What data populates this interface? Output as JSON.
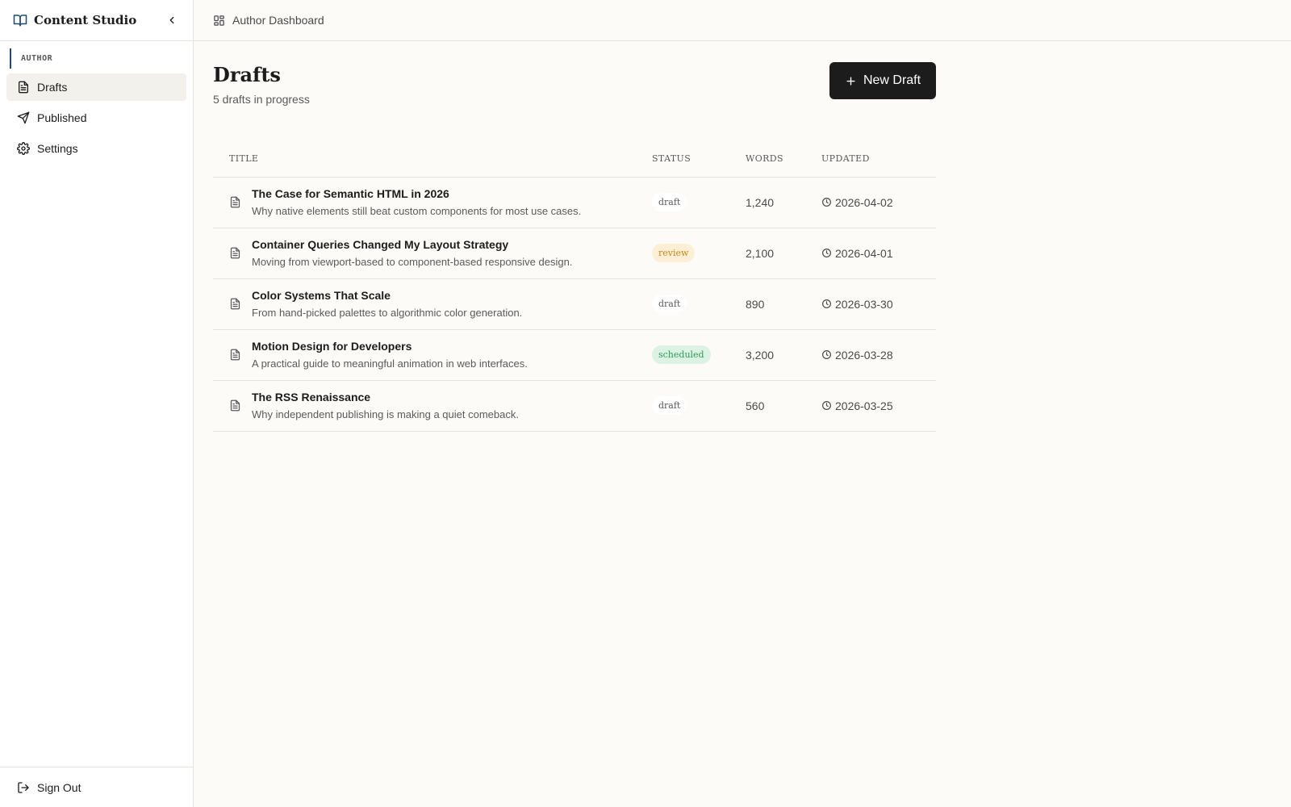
{
  "app": {
    "name": "Content Studio"
  },
  "sidebar": {
    "section_label": "AUTHOR",
    "items": [
      {
        "label": "Drafts",
        "icon": "document-icon",
        "active": true
      },
      {
        "label": "Published",
        "icon": "send-icon",
        "active": false
      },
      {
        "label": "Settings",
        "icon": "gear-icon",
        "active": false
      }
    ],
    "signout_label": "Sign Out"
  },
  "topbar": {
    "breadcrumb": "Author Dashboard"
  },
  "page": {
    "title": "Drafts",
    "subtitle": "5 drafts in progress",
    "new_button_label": "New Draft"
  },
  "table": {
    "headers": {
      "title": "TITLE",
      "status": "STATUS",
      "words": "WORDS",
      "updated": "UPDATED"
    },
    "rows": [
      {
        "title": "The Case for Semantic HTML in 2026",
        "desc": "Why native elements still beat custom components for most use cases.",
        "status": "draft",
        "words": "1,240",
        "updated": "2026-04-02"
      },
      {
        "title": "Container Queries Changed My Layout Strategy",
        "desc": "Moving from viewport-based to component-based responsive design.",
        "status": "review",
        "words": "2,100",
        "updated": "2026-04-01"
      },
      {
        "title": "Color Systems That Scale",
        "desc": "From hand-picked palettes to algorithmic color generation.",
        "status": "draft",
        "words": "890",
        "updated": "2026-03-30"
      },
      {
        "title": "Motion Design for Developers",
        "desc": "A practical guide to meaningful animation in web interfaces.",
        "status": "scheduled",
        "words": "3,200",
        "updated": "2026-03-28"
      },
      {
        "title": "The RSS Renaissance",
        "desc": "Why independent publishing is making a quiet comeback.",
        "status": "draft",
        "words": "560",
        "updated": "2026-03-25"
      }
    ]
  },
  "colors": {
    "accent": "#1f4a6e",
    "button_bg": "#1c1c1c",
    "review": "#c8891f",
    "scheduled": "#2f9a59"
  }
}
